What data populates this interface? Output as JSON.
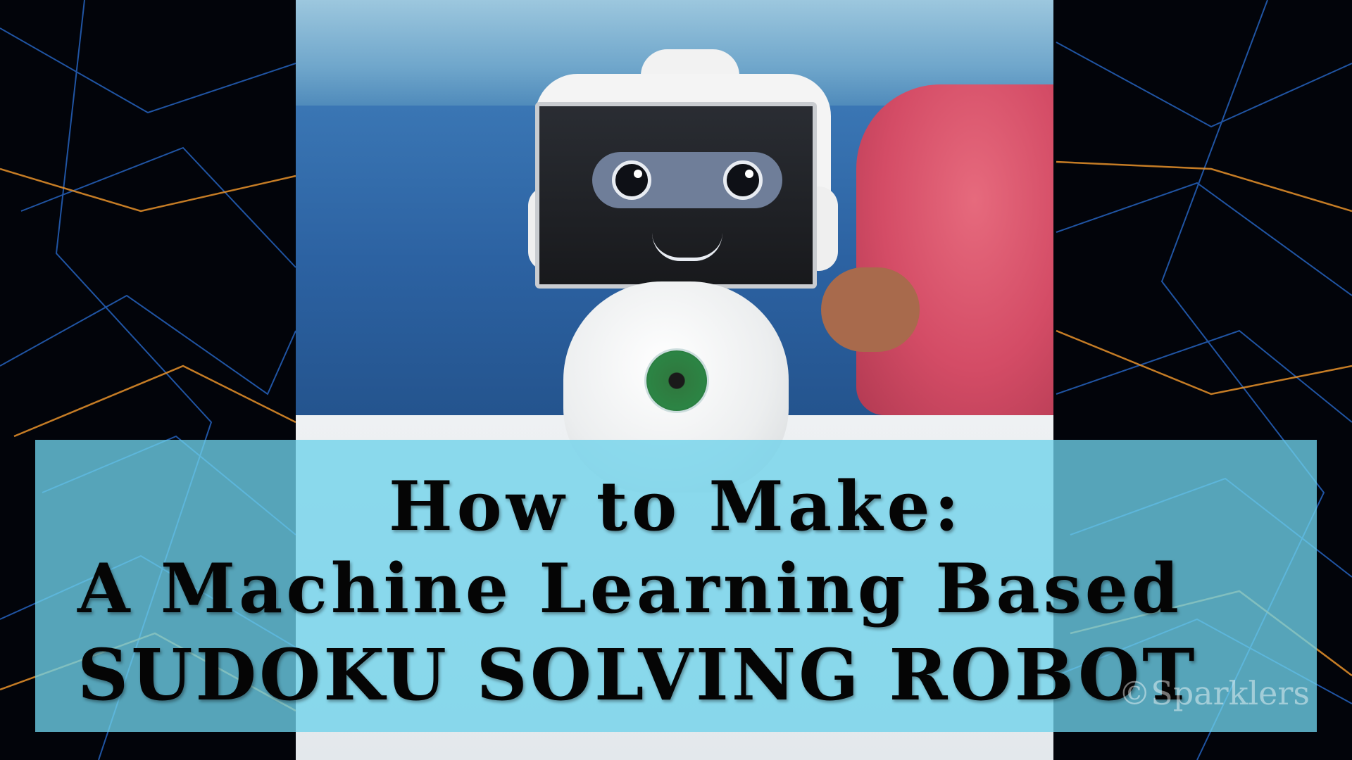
{
  "title": {
    "line1": "How to Make:",
    "line2": "A Machine Learning Based",
    "line3": "SUDOKU SOLVING ROBOT"
  },
  "watermark": "©Sparklers",
  "colors": {
    "overlay": "#6ed2eb",
    "background": "#02040a",
    "network_lines_blue": "#2a6fd6",
    "network_lines_orange": "#e8922a"
  }
}
